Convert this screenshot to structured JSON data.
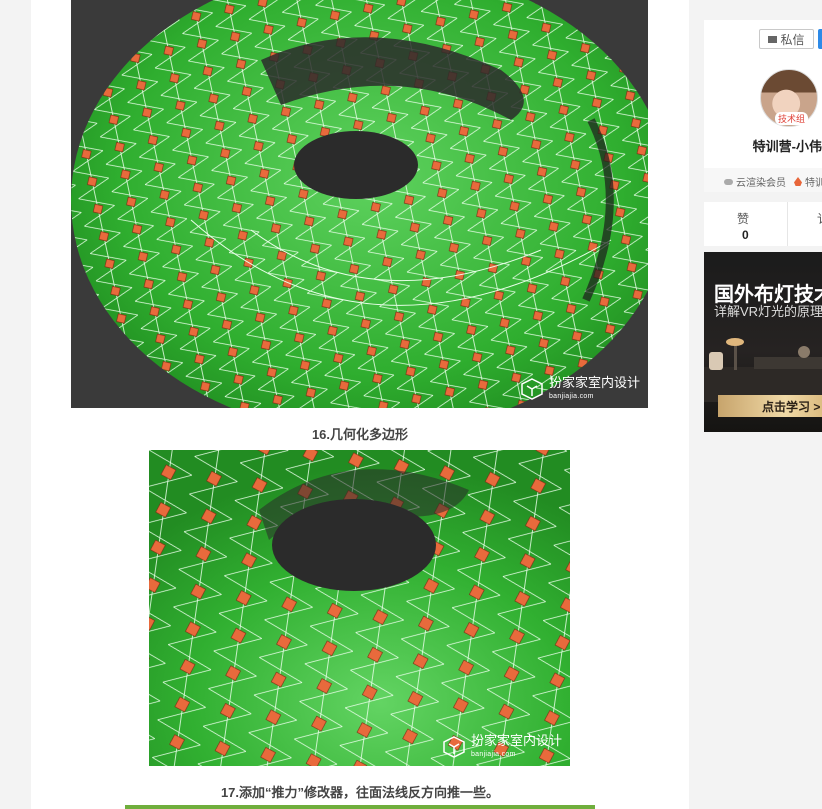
{
  "article": {
    "caption_1": "16.几何化多边形",
    "caption_2": "17.添加“推力”修改器，往面法线反方向推一些。",
    "watermark_name": "扮家家室内设计",
    "watermark_url": "banjiajia.com"
  },
  "sidebar": {
    "message_button": "私信",
    "role_badge": "技术组",
    "username": "特训营-小伟",
    "tag_1": "云渲染会员",
    "tag_2": "特训",
    "likes_label": "赞",
    "likes_value": "0",
    "next_stat_label": "讠"
  },
  "ad": {
    "title": "国外布灯技术",
    "subtitle": "详解VR灯光的原理",
    "cta": "点击学习 >"
  },
  "colors": {
    "mesh_green": "#35b535",
    "poly_marker": "#e86a3c",
    "viewport_bg": "#3a3a3a",
    "accent_blue": "#2d8ae8",
    "badge_red": "#e0443a"
  }
}
